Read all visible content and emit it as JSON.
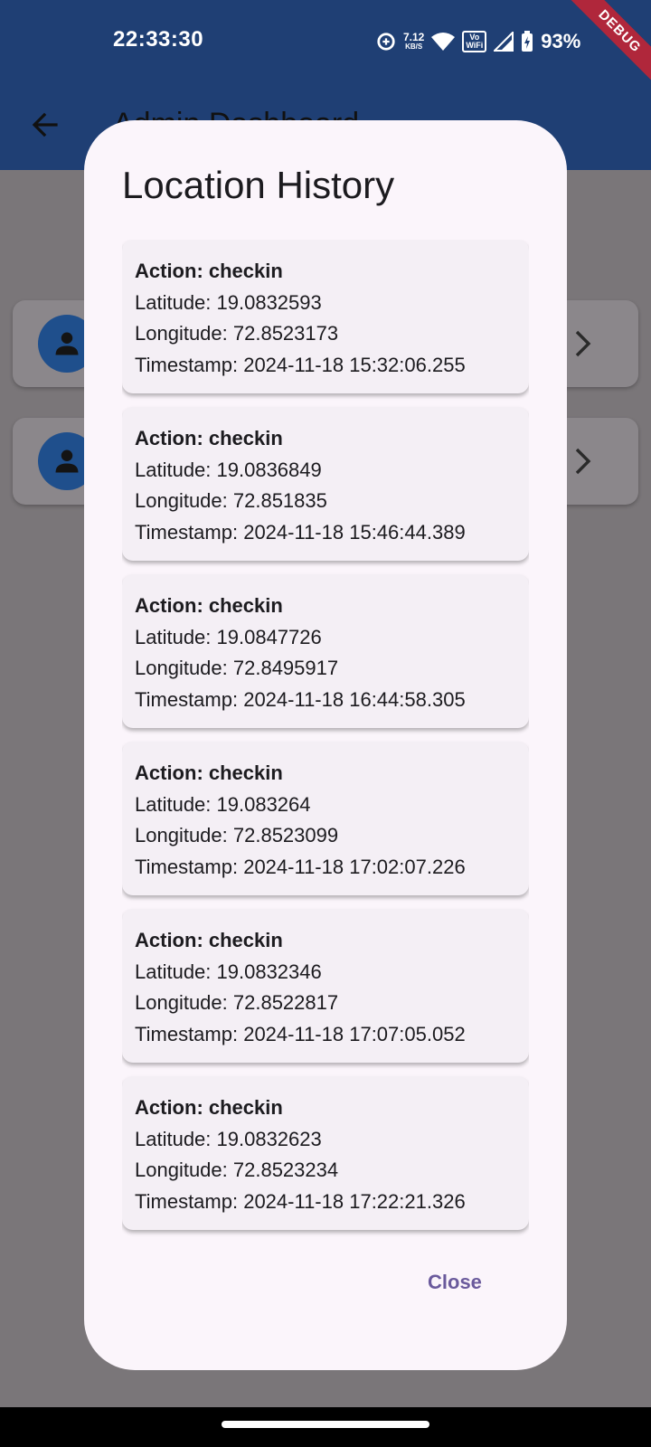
{
  "status_bar": {
    "time": "22:33:30",
    "net_speed_value": "7.12",
    "net_speed_unit": "KB/S",
    "vowifi_top": "Vo",
    "vowifi_bottom": "WiFi",
    "battery": "93%",
    "debug_banner": "DEBUG"
  },
  "app_bar": {
    "title": "Admin Dashboard",
    "back_icon": "arrow-back-icon"
  },
  "background_list": {
    "items": [
      {
        "avatar_icon": "person-icon",
        "chevron_icon": "chevron-right-icon"
      },
      {
        "avatar_icon": "person-icon",
        "chevron_icon": "chevron-right-icon"
      }
    ]
  },
  "dialog": {
    "title": "Location History",
    "close_label": "Close",
    "records": [
      {
        "action": "Action: checkin",
        "latitude": "Latitude: 19.0832593",
        "longitude": "Longitude: 72.8523173",
        "timestamp": "Timestamp: 2024-11-18 15:32:06.255"
      },
      {
        "action": "Action: checkin",
        "latitude": "Latitude: 19.0836849",
        "longitude": "Longitude: 72.851835",
        "timestamp": "Timestamp: 2024-11-18 15:46:44.389"
      },
      {
        "action": "Action: checkin",
        "latitude": "Latitude: 19.0847726",
        "longitude": "Longitude: 72.8495917",
        "timestamp": "Timestamp: 2024-11-18 16:44:58.305"
      },
      {
        "action": "Action: checkin",
        "latitude": "Latitude: 19.083264",
        "longitude": "Longitude: 72.8523099",
        "timestamp": "Timestamp: 2024-11-18 17:02:07.226"
      },
      {
        "action": "Action: checkin",
        "latitude": "Latitude: 19.0832346",
        "longitude": "Longitude: 72.8522817",
        "timestamp": "Timestamp: 2024-11-18 17:07:05.052"
      },
      {
        "action": "Action: checkin",
        "latitude": "Latitude: 19.0832623",
        "longitude": "Longitude: 72.8523234",
        "timestamp": "Timestamp: 2024-11-18 17:22:21.326"
      }
    ]
  },
  "colors": {
    "app_bar": "#1f3f74",
    "scrim": "#7a7679",
    "dialog_bg": "#fbf5fb",
    "card_bg": "#f4eff5",
    "accent": "#6a5a9c"
  }
}
